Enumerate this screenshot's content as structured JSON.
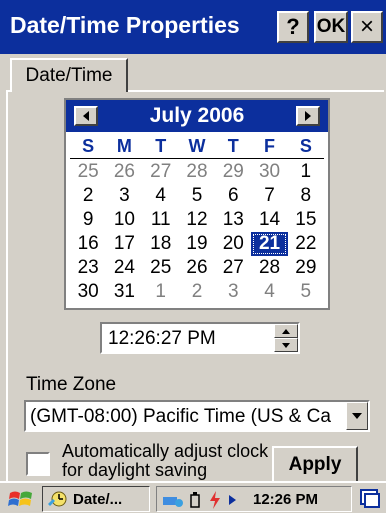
{
  "window": {
    "title": "Date/Time Properties",
    "help_label": "?",
    "ok_label": "OK",
    "close_label": "×"
  },
  "tabs": [
    {
      "label": "Date/Time",
      "active": true
    }
  ],
  "calendar": {
    "month_label": "July 2006",
    "weekdays": [
      "S",
      "M",
      "T",
      "W",
      "T",
      "F",
      "S"
    ],
    "weeks": [
      [
        {
          "d": "25",
          "other": true
        },
        {
          "d": "26",
          "other": true
        },
        {
          "d": "27",
          "other": true
        },
        {
          "d": "28",
          "other": true
        },
        {
          "d": "29",
          "other": true
        },
        {
          "d": "30",
          "other": true
        },
        {
          "d": "1"
        }
      ],
      [
        {
          "d": "2"
        },
        {
          "d": "3"
        },
        {
          "d": "4"
        },
        {
          "d": "5"
        },
        {
          "d": "6"
        },
        {
          "d": "7"
        },
        {
          "d": "8"
        }
      ],
      [
        {
          "d": "9"
        },
        {
          "d": "10"
        },
        {
          "d": "11"
        },
        {
          "d": "12"
        },
        {
          "d": "13"
        },
        {
          "d": "14"
        },
        {
          "d": "15"
        }
      ],
      [
        {
          "d": "16"
        },
        {
          "d": "17"
        },
        {
          "d": "18"
        },
        {
          "d": "19"
        },
        {
          "d": "20"
        },
        {
          "d": "21",
          "selected": true
        },
        {
          "d": "22"
        }
      ],
      [
        {
          "d": "23"
        },
        {
          "d": "24"
        },
        {
          "d": "25"
        },
        {
          "d": "26"
        },
        {
          "d": "27"
        },
        {
          "d": "28"
        },
        {
          "d": "29"
        }
      ],
      [
        {
          "d": "30"
        },
        {
          "d": "31"
        },
        {
          "d": "1",
          "other": true
        },
        {
          "d": "2",
          "other": true
        },
        {
          "d": "3",
          "other": true
        },
        {
          "d": "4",
          "other": true
        },
        {
          "d": "5",
          "other": true
        }
      ]
    ]
  },
  "time": {
    "value": "12:26:27 PM"
  },
  "timezone": {
    "label": "Time Zone",
    "value": "(GMT-08:00) Pacific Time (US & Ca"
  },
  "dst": {
    "label": "Automatically adjust clock for daylight saving",
    "checked": false
  },
  "apply_label": "Apply",
  "taskbar": {
    "task_label": "Date/...",
    "clock": "12:26 PM"
  },
  "colors": {
    "titlebar": "#0c2f9d",
    "face": "#d4d0c8",
    "selected_day": "#0c2f9d"
  }
}
